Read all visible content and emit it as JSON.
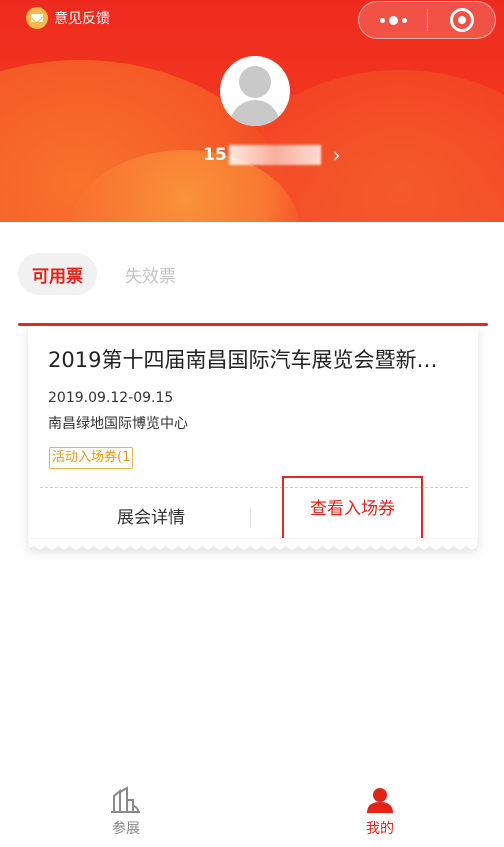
{
  "header": {
    "feedback_label": "意见反馈",
    "capsule": {
      "more_icon": "more-dots-icon",
      "close_icon": "target-circle-icon"
    },
    "user": {
      "phone_visible": "15",
      "phone_rest": "masked",
      "arrow": "›"
    }
  },
  "tabs": [
    {
      "label": "可用票",
      "active": true
    },
    {
      "label": "失效票",
      "active": false
    }
  ],
  "ticket": {
    "title": "2019第十四届南昌国际汽车展览会暨新…",
    "date": "2019.09.12-09.15",
    "venue": "南昌绿地国际博览中心",
    "tag": "活动入场券(1",
    "detail_button": "展会详情",
    "view_button": "查看入场券"
  },
  "nav": {
    "items": [
      {
        "label": "参展",
        "icon": "buildings-icon",
        "active": false
      },
      {
        "label": "我的",
        "icon": "person-icon",
        "active": true
      }
    ]
  },
  "colors": {
    "brand_red": "#e2231a",
    "header_red": "#ee2a1e",
    "tag_gold": "#dd9920"
  }
}
